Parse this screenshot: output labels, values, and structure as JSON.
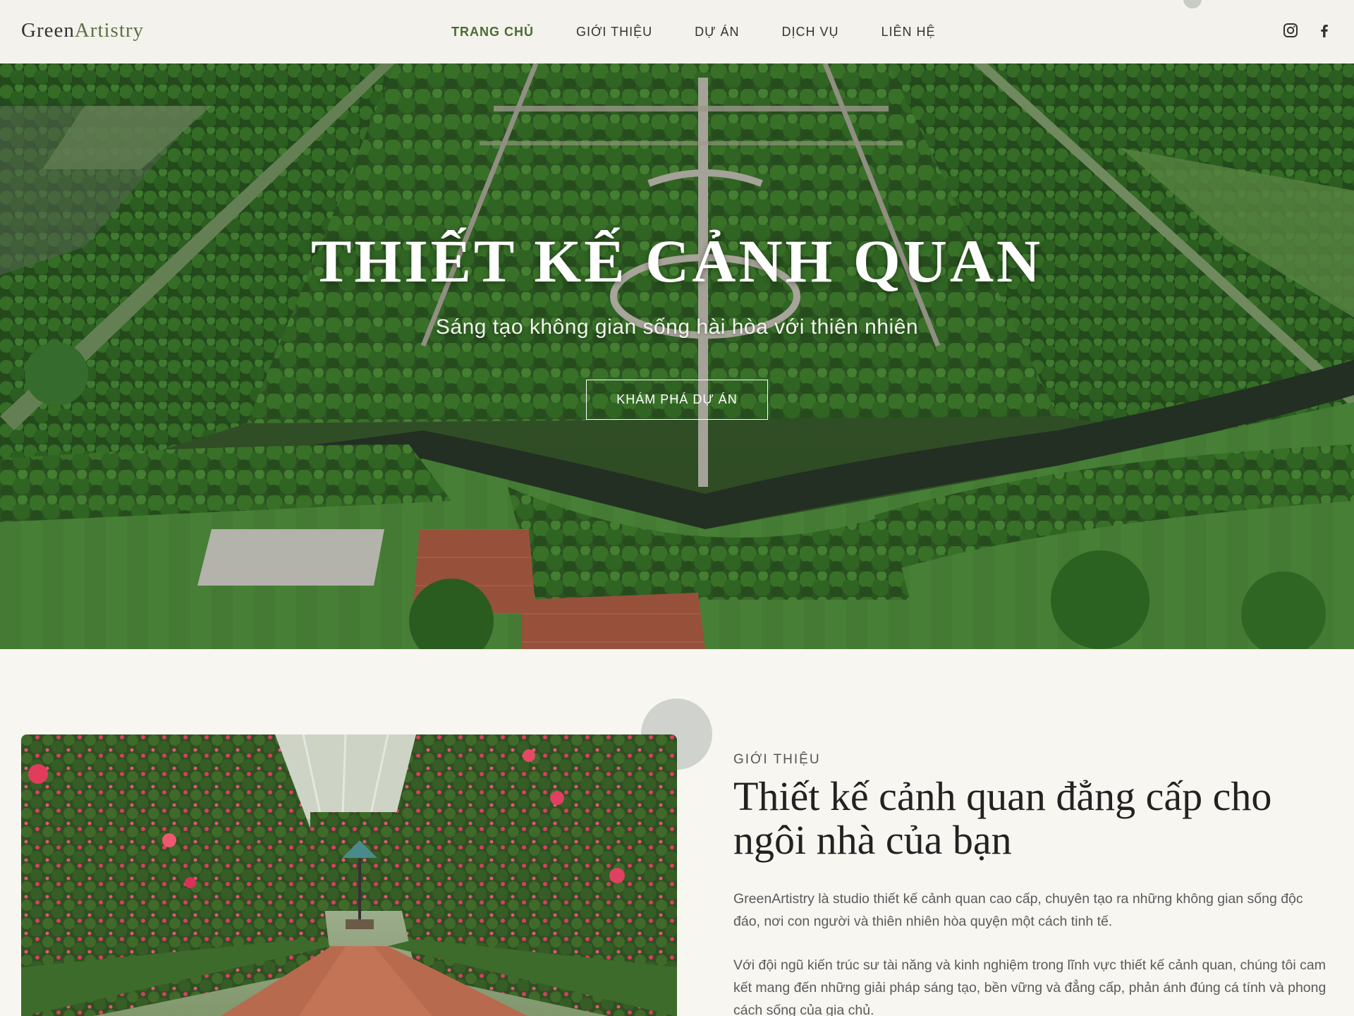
{
  "header": {
    "logo_a": "Green",
    "logo_b": "Artistry",
    "nav": [
      {
        "label": "TRANG CHỦ",
        "active": true
      },
      {
        "label": "GIỚI THIỆU",
        "active": false
      },
      {
        "label": "DỰ ÁN",
        "active": false
      },
      {
        "label": "DỊCH VỤ",
        "active": false
      },
      {
        "label": "LIÊN HỆ",
        "active": false
      }
    ],
    "social_icons": [
      "instagram-icon",
      "facebook-icon"
    ]
  },
  "hero": {
    "title": "THIẾT KẾ CẢNH QUAN",
    "subtitle": "Sáng tạo không gian sống hài hòa với thiên nhiên",
    "cta_label": "KHÁM PHÁ DỰ ÁN"
  },
  "about": {
    "kicker": "GIỚI THIỆU",
    "heading": "Thiết kế cảnh quan đẳng cấp cho ngôi nhà của bạn",
    "paragraph_1": "GreenArtistry là studio thiết kế cảnh quan cao cấp, chuyên tạo ra những không gian sống độc đáo, nơi con người và thiên nhiên hòa quyện một cách tinh tế.",
    "paragraph_2": "Với đội ngũ kiến trúc sư tài năng và kinh nghiệm trong lĩnh vực thiết kế cảnh quan, chúng tôi cam kết mang đến những giải pháp sáng tạo, bền vững và đẳng cấp, phản ánh đúng cá tính và phong cách sống của gia chủ."
  },
  "colors": {
    "accent": "#4b6b32",
    "header_bg": "#f3f2ec",
    "page_bg": "#f8f6f1"
  }
}
